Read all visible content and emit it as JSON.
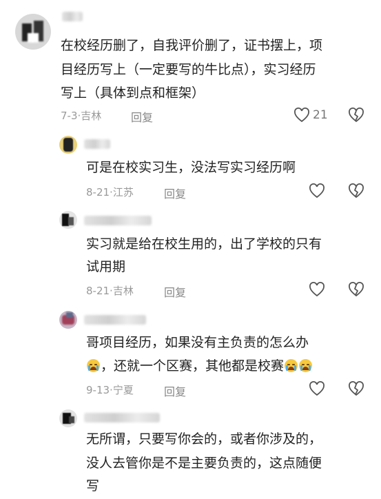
{
  "comments": [
    {
      "text_lines": [
        "在校经历删了，自我评价删了，证书摆上，项",
        "目经历写上（一定要写的牛比点），实习经历",
        "写上（具体到点和框架）"
      ],
      "date": "7-3",
      "location": "吉林",
      "reply_label": "回复",
      "likes": "21"
    },
    {
      "text_lines": [
        "可是在校实习生，没法写实习经历啊"
      ],
      "date": "8-21",
      "location": "江苏",
      "reply_label": "回复"
    },
    {
      "text_lines": [
        "实习就是给在校生用的，出了学校的只有",
        "试用期"
      ],
      "date": "8-21",
      "location": "吉林",
      "reply_label": "回复"
    },
    {
      "text_lines": [
        "哥项目经历，如果没有主负责的怎么办",
        "，还就一个区赛，其他都是校赛"
      ],
      "date": "9-13",
      "location": "宁夏",
      "reply_label": "回复"
    },
    {
      "text_lines": [
        "无所谓，只要写你会的，或者你涉及的，",
        "没人去管你是不是主要负责的，这点随便",
        "写"
      ]
    }
  ],
  "separator": "·",
  "icons": {
    "like": "heart-outline-icon",
    "dislike": "broken-heart-icon",
    "emoji": "crying-face-emoji"
  }
}
